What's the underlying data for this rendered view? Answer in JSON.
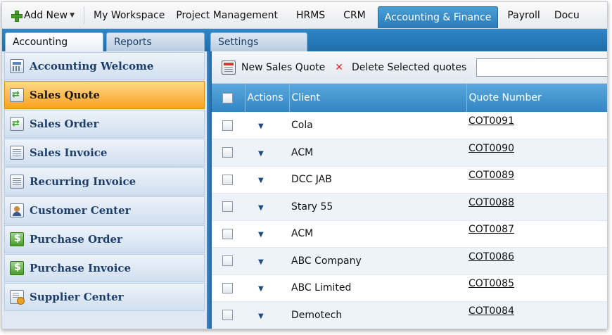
{
  "topnav": {
    "add_new": "Add New",
    "tabs": [
      "My Workspace",
      "Project Management",
      "HRMS",
      "CRM",
      "Accounting & Finance",
      "Payroll",
      "Docu"
    ],
    "active_tab": "Accounting & Finance"
  },
  "subtabs": [
    "Accounting",
    "Reports",
    "Settings"
  ],
  "sidebar": {
    "items": [
      {
        "label": "Accounting Welcome",
        "icon": "calculator-icon"
      },
      {
        "label": "Sales Quote",
        "icon": "quote-icon"
      },
      {
        "label": "Sales Order",
        "icon": "order-icon"
      },
      {
        "label": "Sales Invoice",
        "icon": "invoice-icon"
      },
      {
        "label": "Recurring Invoice",
        "icon": "recurring-invoice-icon"
      },
      {
        "label": "Customer Center",
        "icon": "customer-icon"
      },
      {
        "label": "Purchase Order",
        "icon": "purchase-order-icon"
      },
      {
        "label": "Purchase Invoice",
        "icon": "purchase-invoice-icon"
      },
      {
        "label": "Supplier Center",
        "icon": "supplier-icon"
      }
    ],
    "active": "Sales Quote"
  },
  "toolbar": {
    "new_label": "New Sales Quote",
    "delete_label": "Delete Selected quotes",
    "search_value": ""
  },
  "grid": {
    "columns": [
      "Actions",
      "Client",
      "Quote Number"
    ],
    "rows": [
      {
        "client": "Cola",
        "quote": "COT0091"
      },
      {
        "client": "ACM",
        "quote": "COT0090"
      },
      {
        "client": "DCC JAB",
        "quote": "COT0089"
      },
      {
        "client": "Stary 55",
        "quote": "COT0088"
      },
      {
        "client": "ACM",
        "quote": "COT0087"
      },
      {
        "client": "ABC Company",
        "quote": "COT0086"
      },
      {
        "client": "ABC Limited",
        "quote": "COT0085"
      },
      {
        "client": "Demotech",
        "quote": "COT0084"
      }
    ]
  },
  "colors": {
    "accent_blue": "#2f86c6",
    "active_orange": "#f9a21f",
    "header_blue": "#3286c4"
  }
}
